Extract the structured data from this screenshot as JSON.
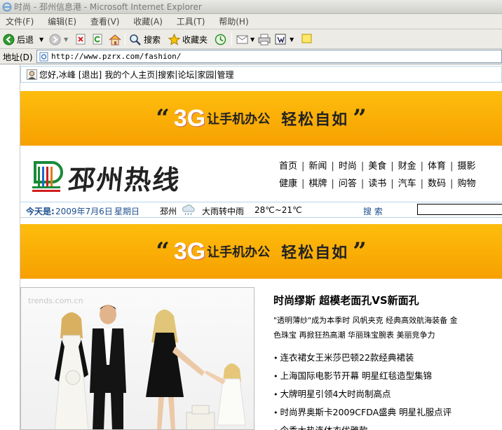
{
  "window": {
    "title": "时尚 - 邳州信息港 - Microsoft Internet Explorer"
  },
  "menu": [
    "文件(F)",
    "编辑(E)",
    "查看(V)",
    "收藏(A)",
    "工具(T)",
    "帮助(H)"
  ],
  "toolbar": {
    "back_label": "后退",
    "search_label": "搜索",
    "favorites_label": "收藏夹"
  },
  "address": {
    "label": "地址(D)",
    "url": "http://www.pzrx.com/fashion/"
  },
  "userbar": {
    "greeting": "您好,冰峰",
    "logout": "[退出]",
    "links": [
      "我的个人主页",
      "搜索",
      "论坛",
      "家园",
      "管理"
    ]
  },
  "banner": {
    "open_quote": "“",
    "brand": "3G",
    "text1": "让手机办公",
    "text2": "轻松自如",
    "close_quote": "”"
  },
  "site": {
    "name": "邳州热线"
  },
  "nav": {
    "row1": [
      "首页",
      "新闻",
      "时尚",
      "美食",
      "财金",
      "体育",
      "摄影"
    ],
    "row2": [
      "健康",
      "棋牌",
      "问答",
      "读书",
      "汽车",
      "数码",
      "购物"
    ]
  },
  "weather": {
    "today_label": "今天是:",
    "date": "2009年7月6日",
    "weekday": "星期日",
    "city": "邳州",
    "condition": "大雨转中雨",
    "temp": "28℃~21℃",
    "search_label": "搜 索"
  },
  "photo": {
    "watermark": "trends.com.cn"
  },
  "article": {
    "headline": "时尚缪斯  超模老面孔VS新面孔",
    "tags_line1": "\"透明薄纱\"成为本季时   风帆夹克   经典高效航海装备   金",
    "tags_line2": "色珠宝  再掀狂热高潮   华丽珠宝腕表  美丽竞争力",
    "items": [
      "连衣裙女王米莎巴顿22款经典裙装",
      "上海国际电影节开幕  明星红毯造型集锦",
      "大牌明星引领4大时尚制高点",
      "时尚界奥斯卡2009CFDA盛典  明星礼服点评",
      "今季大热连体衣优雅款"
    ]
  },
  "colors": {
    "banner_orange": "#f7a000",
    "border_blue": "#b7d5ea",
    "date_blue": "#1c4f8f"
  }
}
